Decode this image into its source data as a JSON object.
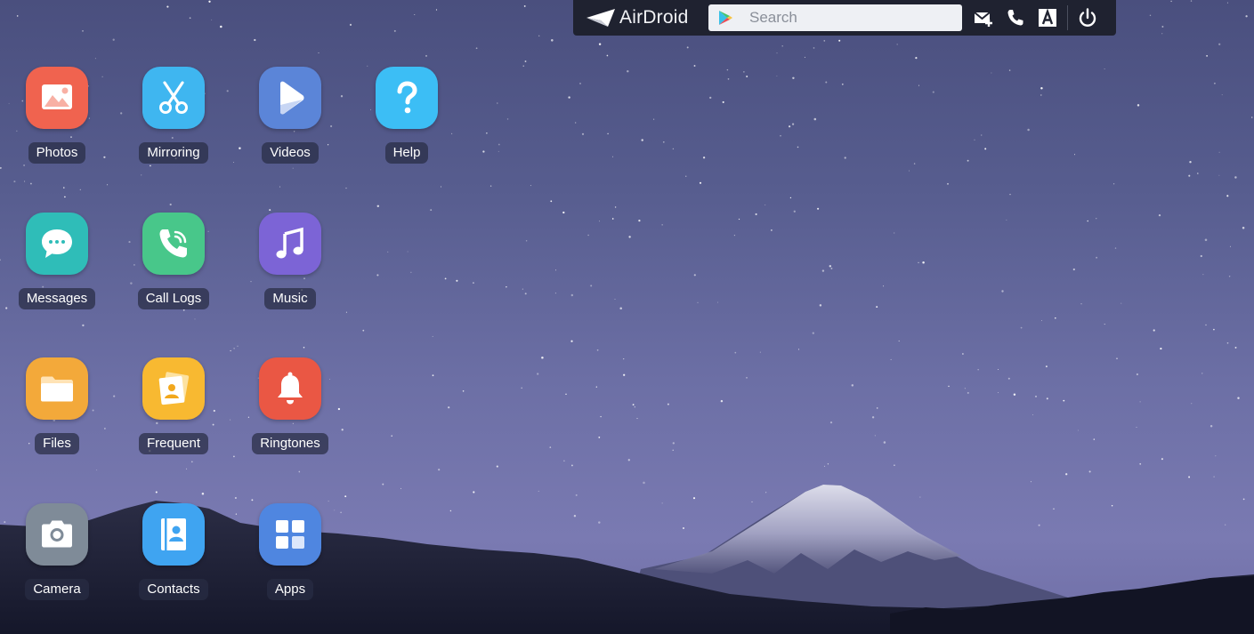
{
  "toolbar": {
    "brand_name": "AirDroid",
    "search_placeholder": "Search",
    "actions": [
      {
        "name": "new-message-icon"
      },
      {
        "name": "phone-icon"
      },
      {
        "name": "font-a-icon"
      },
      {
        "name": "power-icon"
      }
    ]
  },
  "apps": [
    {
      "label": "Photos",
      "icon": "photos-icon",
      "color": "#f0634f"
    },
    {
      "label": "Mirroring",
      "icon": "scissors-icon",
      "color": "#3fb6f0"
    },
    {
      "label": "Videos",
      "icon": "play-icon",
      "color": "#5b85d8"
    },
    {
      "label": "Help",
      "icon": "question-icon",
      "color": "#3cbef5"
    },
    {
      "label": "Messages",
      "icon": "chat-bubble-icon",
      "color": "#2fbdb8"
    },
    {
      "label": "Call Logs",
      "icon": "phone-call-icon",
      "color": "#48c78a"
    },
    {
      "label": "Music",
      "icon": "music-note-icon",
      "color": "#7c64d6"
    },
    {
      "label": "Files",
      "icon": "folder-icon",
      "color": "#f3a93a"
    },
    {
      "label": "Frequent",
      "icon": "frequent-contacts-icon",
      "color": "#f8b931"
    },
    {
      "label": "Ringtones",
      "icon": "bell-icon",
      "color": "#ea5744"
    },
    {
      "label": "Camera",
      "icon": "camera-icon",
      "color": "#7f8b98"
    },
    {
      "label": "Contacts",
      "icon": "contact-book-icon",
      "color": "#3fa4f1"
    },
    {
      "label": "Apps",
      "icon": "apps-grid-icon",
      "color": "#4f86e0"
    }
  ]
}
